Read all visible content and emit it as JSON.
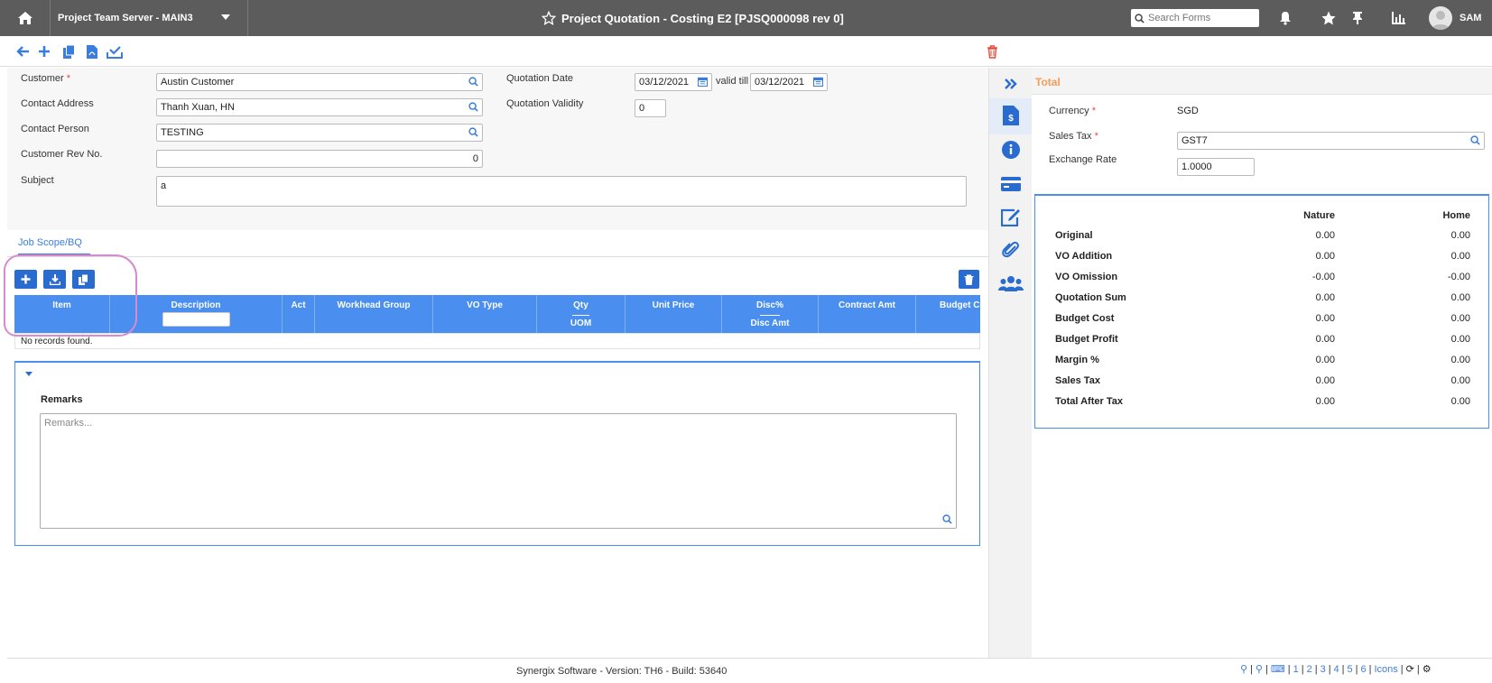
{
  "topbar": {
    "server_label": "Project Team Server - MAIN3",
    "window_title": "Project Quotation - Costing E2 [PJSQ000098 rev 0]",
    "search_placeholder": "Search Forms",
    "user_name": "SAM"
  },
  "form": {
    "customer_label": "Customer",
    "customer_value": "Austin Customer",
    "contact_address_label": "Contact Address",
    "contact_address_value": "Thanh Xuan, HN",
    "contact_person_label": "Contact Person",
    "contact_person_value": "TESTING",
    "customer_rev_label": "Customer Rev No.",
    "customer_rev_value": "0",
    "subject_label": "Subject",
    "subject_value": "a",
    "quotation_date_label": "Quotation Date",
    "quotation_date_value": "03/12/2021",
    "valid_till_label": "valid till",
    "valid_till_value": "03/12/2021",
    "quotation_validity_label": "Quotation Validity",
    "quotation_validity_value": "0",
    "required_mark": "*"
  },
  "tabs": [
    {
      "label": "Job Scope/BQ"
    }
  ],
  "grid": {
    "columns": [
      {
        "label": "Item",
        "sub": ""
      },
      {
        "label": "Description",
        "sub": ""
      },
      {
        "label": "Act",
        "sub": ""
      },
      {
        "label": "Workhead Group",
        "sub": ""
      },
      {
        "label": "VO Type",
        "sub": ""
      },
      {
        "label": "Qty",
        "sub": "UOM"
      },
      {
        "label": "Unit Price",
        "sub": ""
      },
      {
        "label": "Disc%",
        "sub": "Disc Amt"
      },
      {
        "label": "Contract Amt",
        "sub": ""
      },
      {
        "label": "Budget Co",
        "sub": ""
      }
    ],
    "empty_message": "No records found."
  },
  "remarks": {
    "title": "Remarks",
    "placeholder": "Remarks..."
  },
  "total_panel": {
    "header": "Total",
    "currency_label": "Currency",
    "currency_value": "SGD",
    "sales_tax_label": "Sales Tax",
    "sales_tax_value": "GST7",
    "exchange_rate_label": "Exchange Rate",
    "exchange_rate_value": "1.0000",
    "col_nature": "Nature",
    "col_home": "Home",
    "rows": [
      {
        "label": "Original",
        "nature": "0.00",
        "home": "0.00"
      },
      {
        "label": "VO Addition",
        "nature": "0.00",
        "home": "0.00"
      },
      {
        "label": "VO Omission",
        "nature": "-0.00",
        "home": "-0.00"
      },
      {
        "label": "Quotation Sum",
        "nature": "0.00",
        "home": "0.00"
      },
      {
        "label": "Budget Cost",
        "nature": "0.00",
        "home": "0.00"
      },
      {
        "label": "Budget Profit",
        "nature": "0.00",
        "home": "0.00"
      },
      {
        "label": "Margin %",
        "nature": "0.00",
        "home": "0.00"
      },
      {
        "label": "Sales Tax",
        "nature": "0.00",
        "home": "0.00"
      },
      {
        "label": "Total After Tax",
        "nature": "0.00",
        "home": "0.00"
      }
    ]
  },
  "footer": {
    "version_text": "Synergix Software - Version: TH6 - Build: 53640",
    "pages": [
      "1",
      "2",
      "3",
      "4",
      "5",
      "6"
    ],
    "icons_label": "Icons"
  },
  "colors": {
    "accent": "#3b7ddd",
    "grid_header": "#4a8ef0",
    "topbar": "#5c5c5c",
    "delete_red": "#e74c3c",
    "total_orange": "#f39c5a"
  }
}
